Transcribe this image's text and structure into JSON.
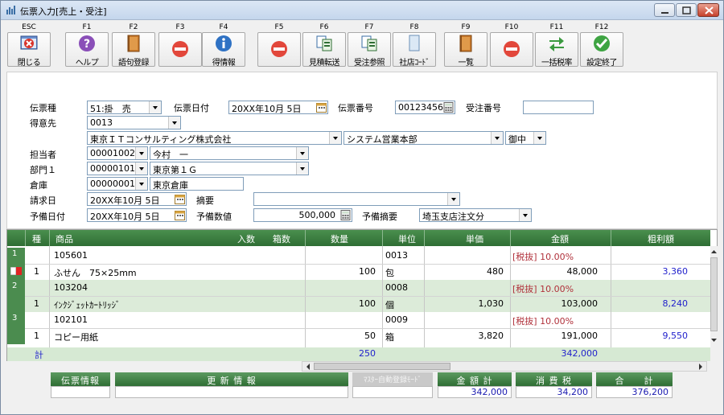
{
  "window": {
    "title": "伝票入力[売上・受注]"
  },
  "toolbar": [
    {
      "key": "ESC",
      "label": "閉じる",
      "icon": "close-window-icon"
    },
    {
      "key": "F1",
      "label": "ヘルプ",
      "icon": "help-icon"
    },
    {
      "key": "F2",
      "label": "語句登録",
      "icon": "book-icon"
    },
    {
      "key": "F3",
      "label": "",
      "icon": "prohibited-icon"
    },
    {
      "key": "F4",
      "label": "得情報",
      "icon": "info-icon"
    },
    {
      "key": "F5",
      "label": "",
      "icon": "prohibited-icon"
    },
    {
      "key": "F6",
      "label": "見積転送",
      "icon": "document-transfer-icon"
    },
    {
      "key": "F7",
      "label": "受注参照",
      "icon": "document-reference-icon"
    },
    {
      "key": "F8",
      "label": "社店ｺｰﾄﾞ",
      "icon": "blank-page-icon"
    },
    {
      "key": "F9",
      "label": "一覧",
      "icon": "list-book-icon"
    },
    {
      "key": "F10",
      "label": "",
      "icon": "prohibited-icon"
    },
    {
      "key": "F11",
      "label": "一括税率",
      "icon": "swap-arrows-icon"
    },
    {
      "key": "F12",
      "label": "設定終了",
      "icon": "checkmark-icon"
    }
  ],
  "form": {
    "slip_type_label": "伝票種",
    "slip_type_value": "51:掛　売",
    "slip_date_label": "伝票日付",
    "slip_date_value": "20XX年10月 5日",
    "slip_no_label": "伝票番号",
    "slip_no_value": "00123456",
    "order_no_label": "受注番号",
    "order_no_value": "",
    "customer_label": "得意先",
    "customer_code": "0013",
    "customer_name": "東京ＩＴコンサルティング株式会社",
    "customer_dept": "システム営業本部",
    "honorific": "御中",
    "staff_label": "担当者",
    "staff_code": "00001002",
    "staff_name": "今村　一",
    "dept_label": "部門１",
    "dept_code": "00000101",
    "dept_name": "東京第１Ｇ",
    "warehouse_label": "倉庫",
    "warehouse_code": "00000001",
    "warehouse_name": "東京倉庫",
    "billing_date_label": "請求日",
    "billing_date_value": "20XX年10月 5日",
    "summary_label": "摘要",
    "summary_value": "",
    "reserve_date_label": "予備日付",
    "reserve_date_value": "20XX年10月 5日",
    "reserve_num_label": "予備数値",
    "reserve_num_value": "500,000",
    "reserve_summary_label": "予備摘要",
    "reserve_summary_value": "埼玉支店注文分"
  },
  "grid": {
    "headers": {
      "kind": "種",
      "item": "商品",
      "qty_per": "入数",
      "boxes": "箱数",
      "qty": "数量",
      "unit": "単位",
      "price": "単価",
      "amount": "金額",
      "gross": "粗利額"
    },
    "rows": [
      {
        "no": "1",
        "kind": "1",
        "code": "105601",
        "name": "ふせん　75×25mm",
        "qty": "100",
        "unit_code": "0013",
        "unit": "包",
        "price": "480",
        "tax": "[税抜] 10.00%",
        "amount": "48,000",
        "gross": "3,360"
      },
      {
        "no": "2",
        "kind": "1",
        "code": "103204",
        "name": "ｲﾝｸｼﾞｪｯﾄｶｰﾄﾘｯｼﾞ",
        "qty": "100",
        "unit_code": "0008",
        "unit": "個",
        "price": "1,030",
        "tax": "[税抜] 10.00%",
        "amount": "103,000",
        "gross": "8,240"
      },
      {
        "no": "3",
        "kind": "1",
        "code": "102101",
        "name": "コピー用紙",
        "qty": "50",
        "unit_code": "0009",
        "unit": "箱",
        "price": "3,820",
        "tax": "[税抜] 10.00%",
        "amount": "191,000",
        "gross": "9,550"
      }
    ],
    "total_label": "計",
    "total_qty": "250",
    "total_amount": "342,000"
  },
  "footer": {
    "slip_info_label": "伝票情報",
    "update_info_label": "更 新 情 報",
    "master_auto_label": "ﾏｽﾀｰ自動登録ﾓｰﾄﾞ",
    "subtotal_label": "金 額 計",
    "subtotal_value": "342,000",
    "tax_label": "消 費 税",
    "tax_value": "34,200",
    "total_label": "合　　計",
    "total_value": "376,200"
  }
}
